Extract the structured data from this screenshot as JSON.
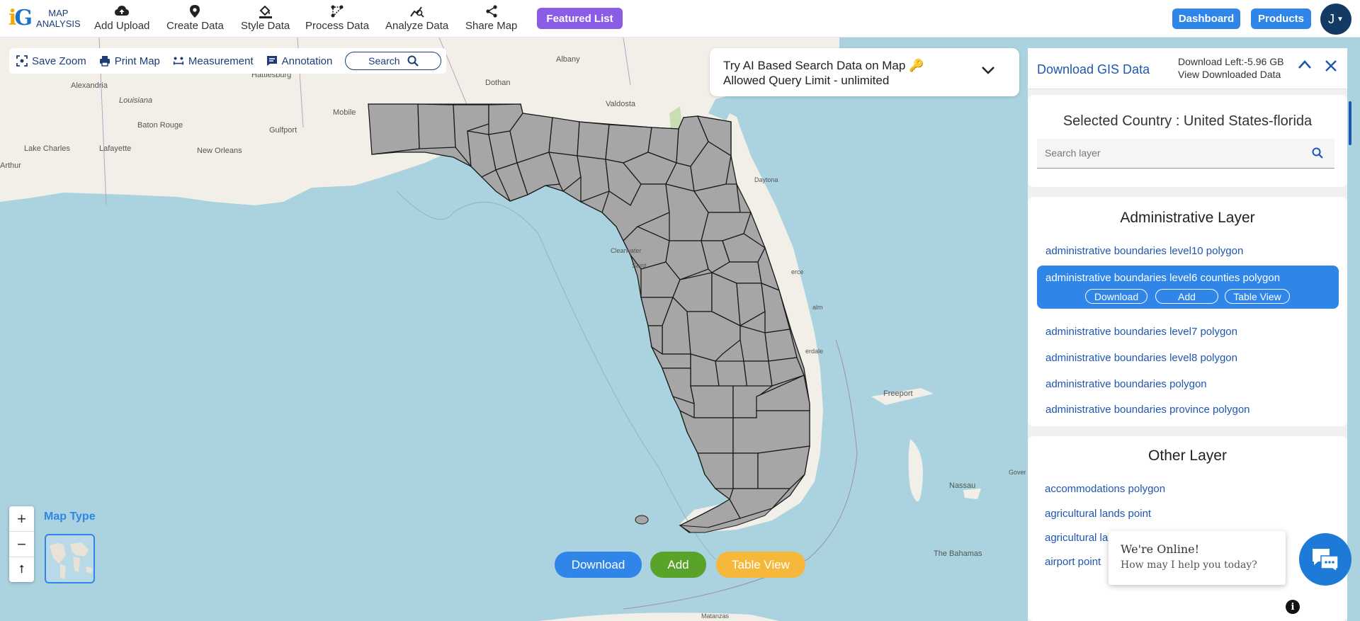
{
  "app": {
    "logo_text_line1": "MAP",
    "logo_text_line2": "ANALYSIS"
  },
  "nav": {
    "items": [
      {
        "label": "Add Upload",
        "icon": "cloud-upload-icon"
      },
      {
        "label": "Create Data",
        "icon": "map-pin-icon"
      },
      {
        "label": "Style Data",
        "icon": "paint-bucket-icon"
      },
      {
        "label": "Process Data",
        "icon": "process-icon"
      },
      {
        "label": "Analyze Data",
        "icon": "analyze-icon"
      },
      {
        "label": "Share Map",
        "icon": "share-icon"
      }
    ],
    "featured_label": "Featured List",
    "dashboard_label": "Dashboard",
    "products_label": "Products",
    "user_initial": "J"
  },
  "toolbar": {
    "save_zoom": "Save Zoom",
    "print_map": "Print Map",
    "measurement": "Measurement",
    "annotation": "Annotation",
    "search": "Search"
  },
  "ai_banner": {
    "line1": "Try AI Based Search Data on Map 🔑",
    "line2": "Allowed Query Limit - unlimited"
  },
  "map": {
    "labels": {
      "albany": "Albany",
      "hattiesburg": "Hattiesburg",
      "alexandria": "Alexandria",
      "dothan": "Dothan",
      "louisiana": "Louisiana",
      "mobile": "Mobile",
      "valdosta": "Valdosta",
      "baton_rouge": "Baton Rouge",
      "gulfport": "Gulfport",
      "lake_charles": "Lake Charles",
      "lafayette": "Lafayette",
      "new_orleans": "New Orleans",
      "arthur": "Arthur",
      "daytona": "Daytona",
      "clearwater": "Clearwater",
      "saint": "Saint",
      "pierce": "erce",
      "palm": "alm",
      "lauderdale": "erdale",
      "freeport": "Freeport",
      "nassau": "Nassau",
      "the_bahamas": "The Bahamas",
      "matanzas": "Matanzas",
      "gov": "Gover"
    },
    "map_type_label": "Map Type",
    "zoom_in": "+",
    "zoom_out": "−",
    "reset_bearing": "⭡"
  },
  "actions": {
    "download": "Download",
    "add": "Add",
    "table_view": "Table View"
  },
  "panel": {
    "title": "Download GIS Data",
    "download_left": "Download Left:-5.96 GB",
    "view_downloaded": "View Downloaded Data",
    "selected_country": "Selected Country : United States-florida",
    "search_placeholder": "Search layer",
    "admin_title": "Administrative Layer",
    "admin_layers": [
      "administrative boundaries level10 polygon",
      "administrative boundaries level6 counties polygon",
      "administrative boundaries level7 polygon",
      "administrative boundaries level8 polygon",
      "administrative boundaries polygon",
      "administrative boundaries province polygon"
    ],
    "selected_actions": {
      "download": "Download",
      "add": "Add",
      "table_view": "Table View"
    },
    "other_title": "Other Layer",
    "other_layers": [
      "accommodations polygon",
      "agricultural lands point",
      "agricultural la",
      "airport point"
    ]
  },
  "chat": {
    "line1": "We're Online!",
    "line2": "How may I help you today?"
  },
  "colors": {
    "accent_blue": "#2f86e8",
    "featured_purple": "#8b5ce6",
    "add_green": "#5aa32a",
    "table_view_orange": "#f5b83a",
    "county_fill": "#a6a6a6",
    "water": "#aad3df"
  }
}
